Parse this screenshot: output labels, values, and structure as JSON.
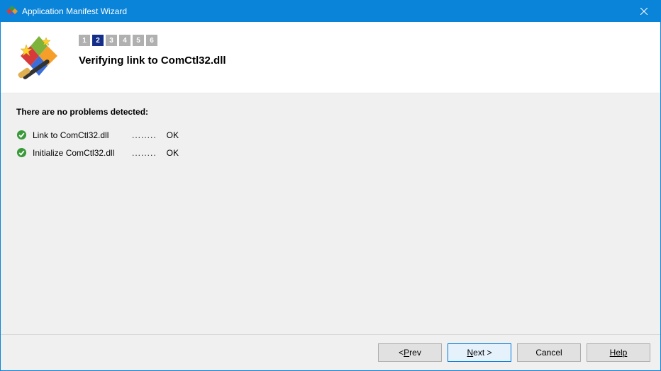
{
  "window": {
    "title": "Application Manifest Wizard"
  },
  "header": {
    "steps": [
      "1",
      "2",
      "3",
      "4",
      "5",
      "6"
    ],
    "active_step_index": 1,
    "page_title": "Verifying link to ComCtl32.dll"
  },
  "content": {
    "heading": "There are no problems detected:",
    "items": [
      {
        "label": "Link to ComCtl32.dll",
        "dots": "........",
        "value": "OK"
      },
      {
        "label": "Initialize ComCtl32.dll",
        "dots": "........",
        "value": "OK"
      }
    ]
  },
  "footer": {
    "prev": "< Prev",
    "next": "Next >",
    "cancel": "Cancel",
    "help": "Help"
  }
}
